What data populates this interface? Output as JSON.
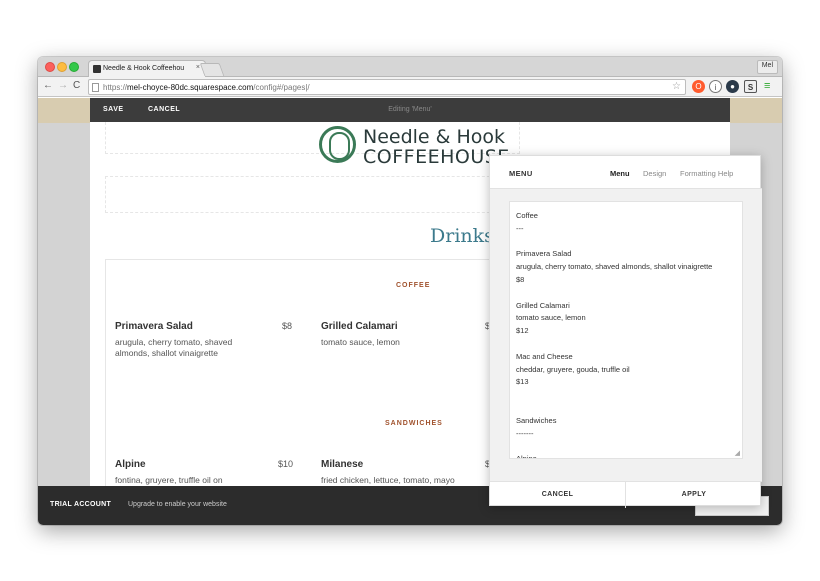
{
  "browser": {
    "tab_title": "Needle & Hook Coffeehou",
    "tab_close": "×",
    "profile": "Mel",
    "url_scheme": "https://",
    "url_host": "mel-choyce-80dc.squarespace.com",
    "url_path": "/config#/pages|/"
  },
  "editor_bar": {
    "save_label": "SAVE",
    "cancel_label": "CANCEL",
    "status": "Editing 'Menu'"
  },
  "site": {
    "logo_line1": "Needle & Hook",
    "logo_line2": "COFFEEHOUSE",
    "page_heading": "Drinks",
    "sections": [
      {
        "label": "COFFEE",
        "items": [
          {
            "name": "Primavera Salad",
            "price": "$8",
            "desc": "arugula, cherry tomato, shaved almonds, shallot vinaigrette"
          },
          {
            "name": "Grilled Calamari",
            "price": "$",
            "desc": "tomato sauce, lemon"
          }
        ]
      },
      {
        "label": "SANDWICHES",
        "items": [
          {
            "name": "Alpine",
            "price": "$10",
            "desc": "fontina, gruyere, truffle oil on"
          },
          {
            "name": "Milanese",
            "price": "$",
            "desc": "fried chicken, lettuce, tomato, mayo"
          }
        ]
      }
    ]
  },
  "trial": {
    "title": "TRIAL ACCOUNT",
    "message": "Upgrade to enable your website"
  },
  "panel": {
    "title": "MENU",
    "tabs": [
      "Menu",
      "Design",
      "Formatting Help"
    ],
    "lines": [
      "Coffee",
      "---",
      "",
      "Primavera Salad",
      "arugula, cherry tomato, shaved almonds, shallot vinaigrette",
      "$8",
      "",
      "Grilled Calamari",
      "tomato sauce, lemon",
      "$12",
      "",
      "Mac and Cheese",
      "cheddar, gruyere, gouda, truffle oil",
      "$13",
      "",
      "",
      "Sandwiches",
      "-------",
      "",
      "Alpine"
    ],
    "cancel_label": "CANCEL",
    "apply_label": "APPLY"
  },
  "colors": {
    "accent_teal": "#3c7a8c",
    "section_brown": "#a0522d",
    "logo_green": "#3b7a57",
    "dark_bar": "#3c3c3c"
  }
}
